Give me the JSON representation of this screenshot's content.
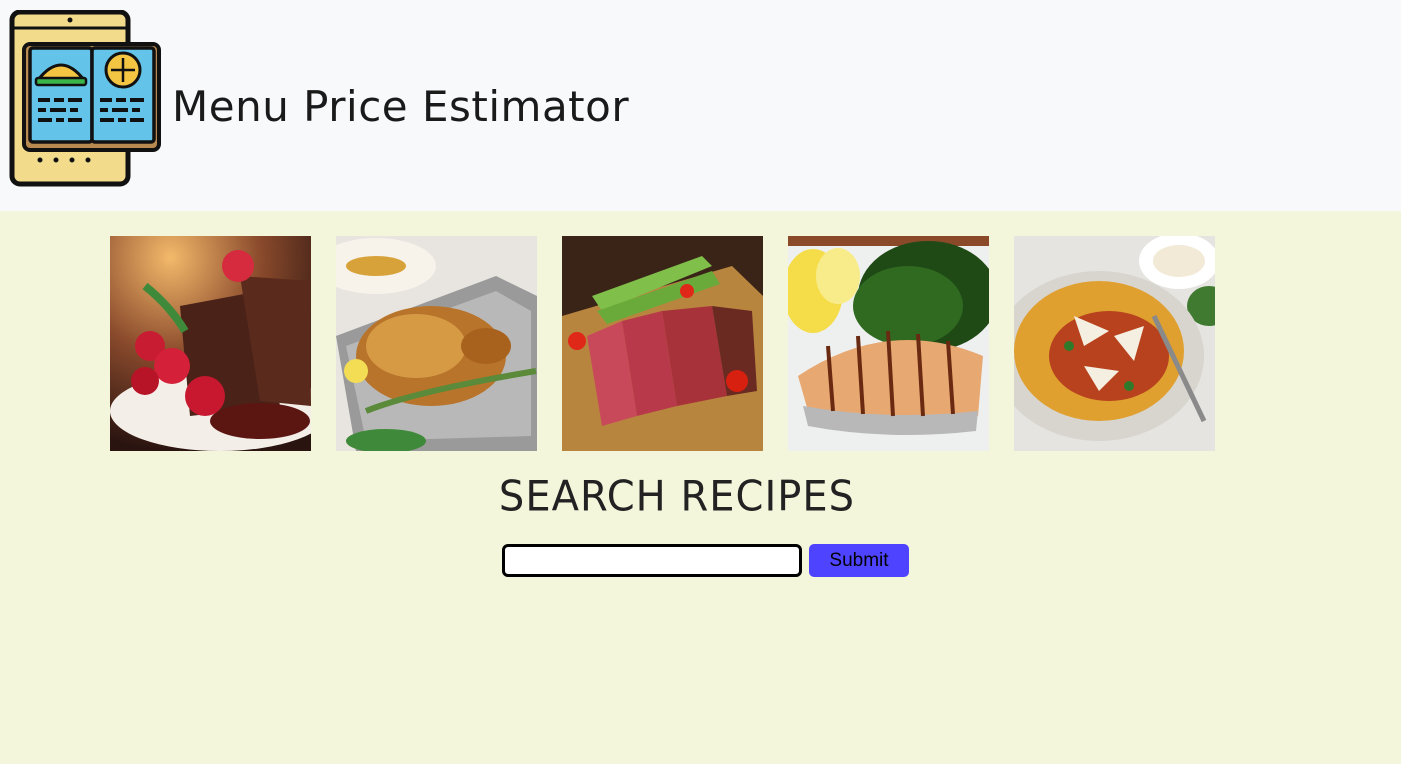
{
  "header": {
    "title": "Menu Price Estimator",
    "logo_icon": "menu-book-icon"
  },
  "gallery": {
    "items": [
      {
        "name": "chocolate-lava-cake-image"
      },
      {
        "name": "roast-chicken-image"
      },
      {
        "name": "sliced-steak-image"
      },
      {
        "name": "grilled-salmon-image"
      },
      {
        "name": "spaghetti-bolognese-image"
      }
    ]
  },
  "search": {
    "heading": "SEARCH RECIPES",
    "input_value": "",
    "input_placeholder": "",
    "submit_label": "Submit"
  },
  "colors": {
    "page_background": "#f4f6dc",
    "header_background": "#f8f9fa",
    "submit_button": "#4e44ff"
  }
}
